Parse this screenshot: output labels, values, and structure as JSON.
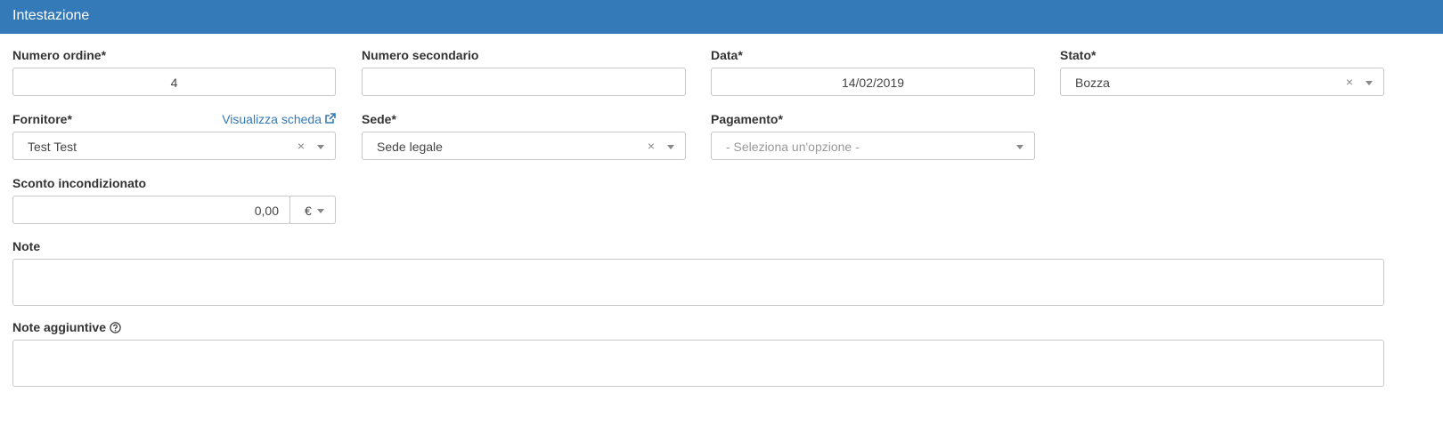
{
  "header": {
    "title": "Intestazione"
  },
  "form": {
    "numero_ordine": {
      "label": "Numero ordine*",
      "value": "4"
    },
    "numero_secondario": {
      "label": "Numero secondario",
      "value": ""
    },
    "data": {
      "label": "Data*",
      "value": "14/02/2019"
    },
    "stato": {
      "label": "Stato*",
      "value": "Bozza"
    },
    "fornitore": {
      "label": "Fornitore*",
      "link": "Visualizza scheda",
      "value": "Test Test"
    },
    "sede": {
      "label": "Sede*",
      "value": "Sede legale"
    },
    "pagamento": {
      "label": "Pagamento*",
      "placeholder": "- Seleziona un'opzione -"
    },
    "sconto": {
      "label": "Sconto incondizionato",
      "value": "0,00",
      "unit": "€"
    },
    "note": {
      "label": "Note",
      "value": ""
    },
    "note_aggiuntive": {
      "label": "Note aggiuntive",
      "value": ""
    }
  },
  "icons": {
    "clear": "×",
    "external_link": "external-link-icon",
    "help": "question-circle-icon"
  },
  "colors": {
    "header_bg": "#3479b8",
    "link": "#3479b8"
  }
}
